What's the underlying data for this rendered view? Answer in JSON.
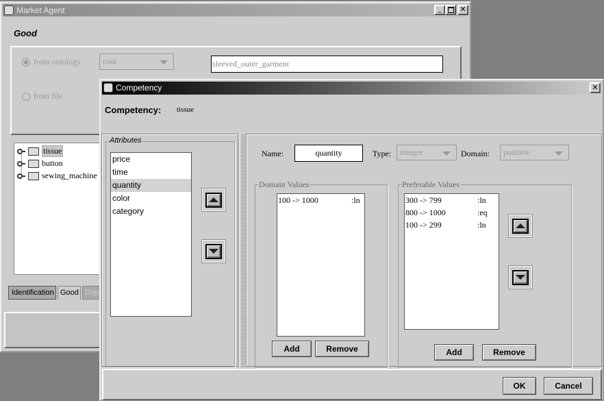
{
  "market_agent": {
    "title": "Market Agent",
    "section_title": "Good",
    "radio_ontology": "from ontology",
    "radio_file": "from file",
    "ontology_combo": "coat",
    "ontology_field": "sleeved_outer_garment",
    "tree": [
      {
        "label": "tissue"
      },
      {
        "label": "button"
      },
      {
        "label": "sewing_machine"
      }
    ],
    "tabs": [
      {
        "label": "Identification"
      },
      {
        "label": "Good"
      },
      {
        "label": "Dep"
      }
    ]
  },
  "competency": {
    "title": "Competency",
    "header_label": "Competency:",
    "header_value": "tissue",
    "attributes": {
      "legend": "Attributes",
      "items": [
        "price",
        "time",
        "quantity",
        "color",
        "category"
      ],
      "selected": "quantity"
    },
    "name_label": "Name:",
    "name_value": "quantity",
    "type_label": "Type:",
    "type_value": "integer",
    "domain_label": "Domain:",
    "domain_value": "positive",
    "domain_values": {
      "legend": "Domain Values",
      "items": [
        {
          "range": "100 -> 1000",
          "op": ":ln"
        }
      ],
      "add": "Add",
      "remove": "Remove"
    },
    "preferable_values": {
      "legend": "Preferable Values",
      "items": [
        {
          "range": "300 -> 799",
          "op": ":ln"
        },
        {
          "range": "800 -> 1000",
          "op": ":eq"
        },
        {
          "range": "100 -> 299",
          "op": ":ln"
        }
      ],
      "add": "Add",
      "remove": "Remove"
    },
    "ok": "OK",
    "cancel": "Cancel"
  }
}
